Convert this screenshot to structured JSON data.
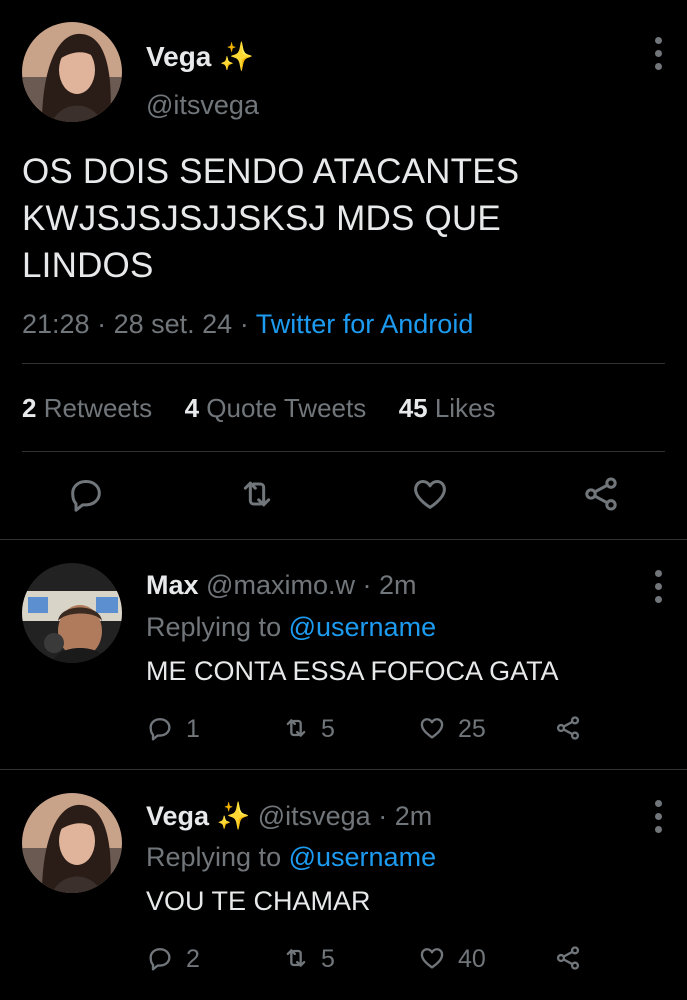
{
  "main_tweet": {
    "author_name": "Vega",
    "author_emoji": "✨",
    "handle": "@itsvega",
    "text_lines": [
      "OS DOIS SENDO ATACANTES",
      "KWJSJSJSJJSKSJ MDS QUE",
      "LINDOS"
    ],
    "time": "21:28",
    "date": "28 set. 24",
    "client": "Twitter for Android",
    "retweets_count": "2",
    "retweets_label": "Retweets",
    "quotes_count": "4",
    "quotes_label": "Quote Tweets",
    "likes_count": "45",
    "likes_label": "Likes"
  },
  "replies": [
    {
      "name": "Max",
      "emoji": "",
      "handle": "@maximo.w",
      "time": "2m",
      "replying_prefix": "Replying to",
      "replying_to": "@username",
      "text": "ME CONTA ESSA FOFOCA GATA",
      "reply_count": "1",
      "retweet_count": "5",
      "like_count": "25"
    },
    {
      "name": "Vega",
      "emoji": "✨",
      "handle": "@itsvega",
      "time": "2m",
      "replying_prefix": "Replying to",
      "replying_to": "@username",
      "text": "VOU TE CHAMAR",
      "reply_count": "2",
      "retweet_count": "5",
      "like_count": "40"
    }
  ],
  "icons": {
    "reply": "reply-icon",
    "retweet": "retweet-icon",
    "like": "heart-icon",
    "share": "share-icon",
    "more": "more-vertical-icon"
  },
  "colors": {
    "background": "#000000",
    "text": "#e7e9ea",
    "secondary": "#71767b",
    "link": "#1d9bf0",
    "divider": "#2f3336"
  }
}
